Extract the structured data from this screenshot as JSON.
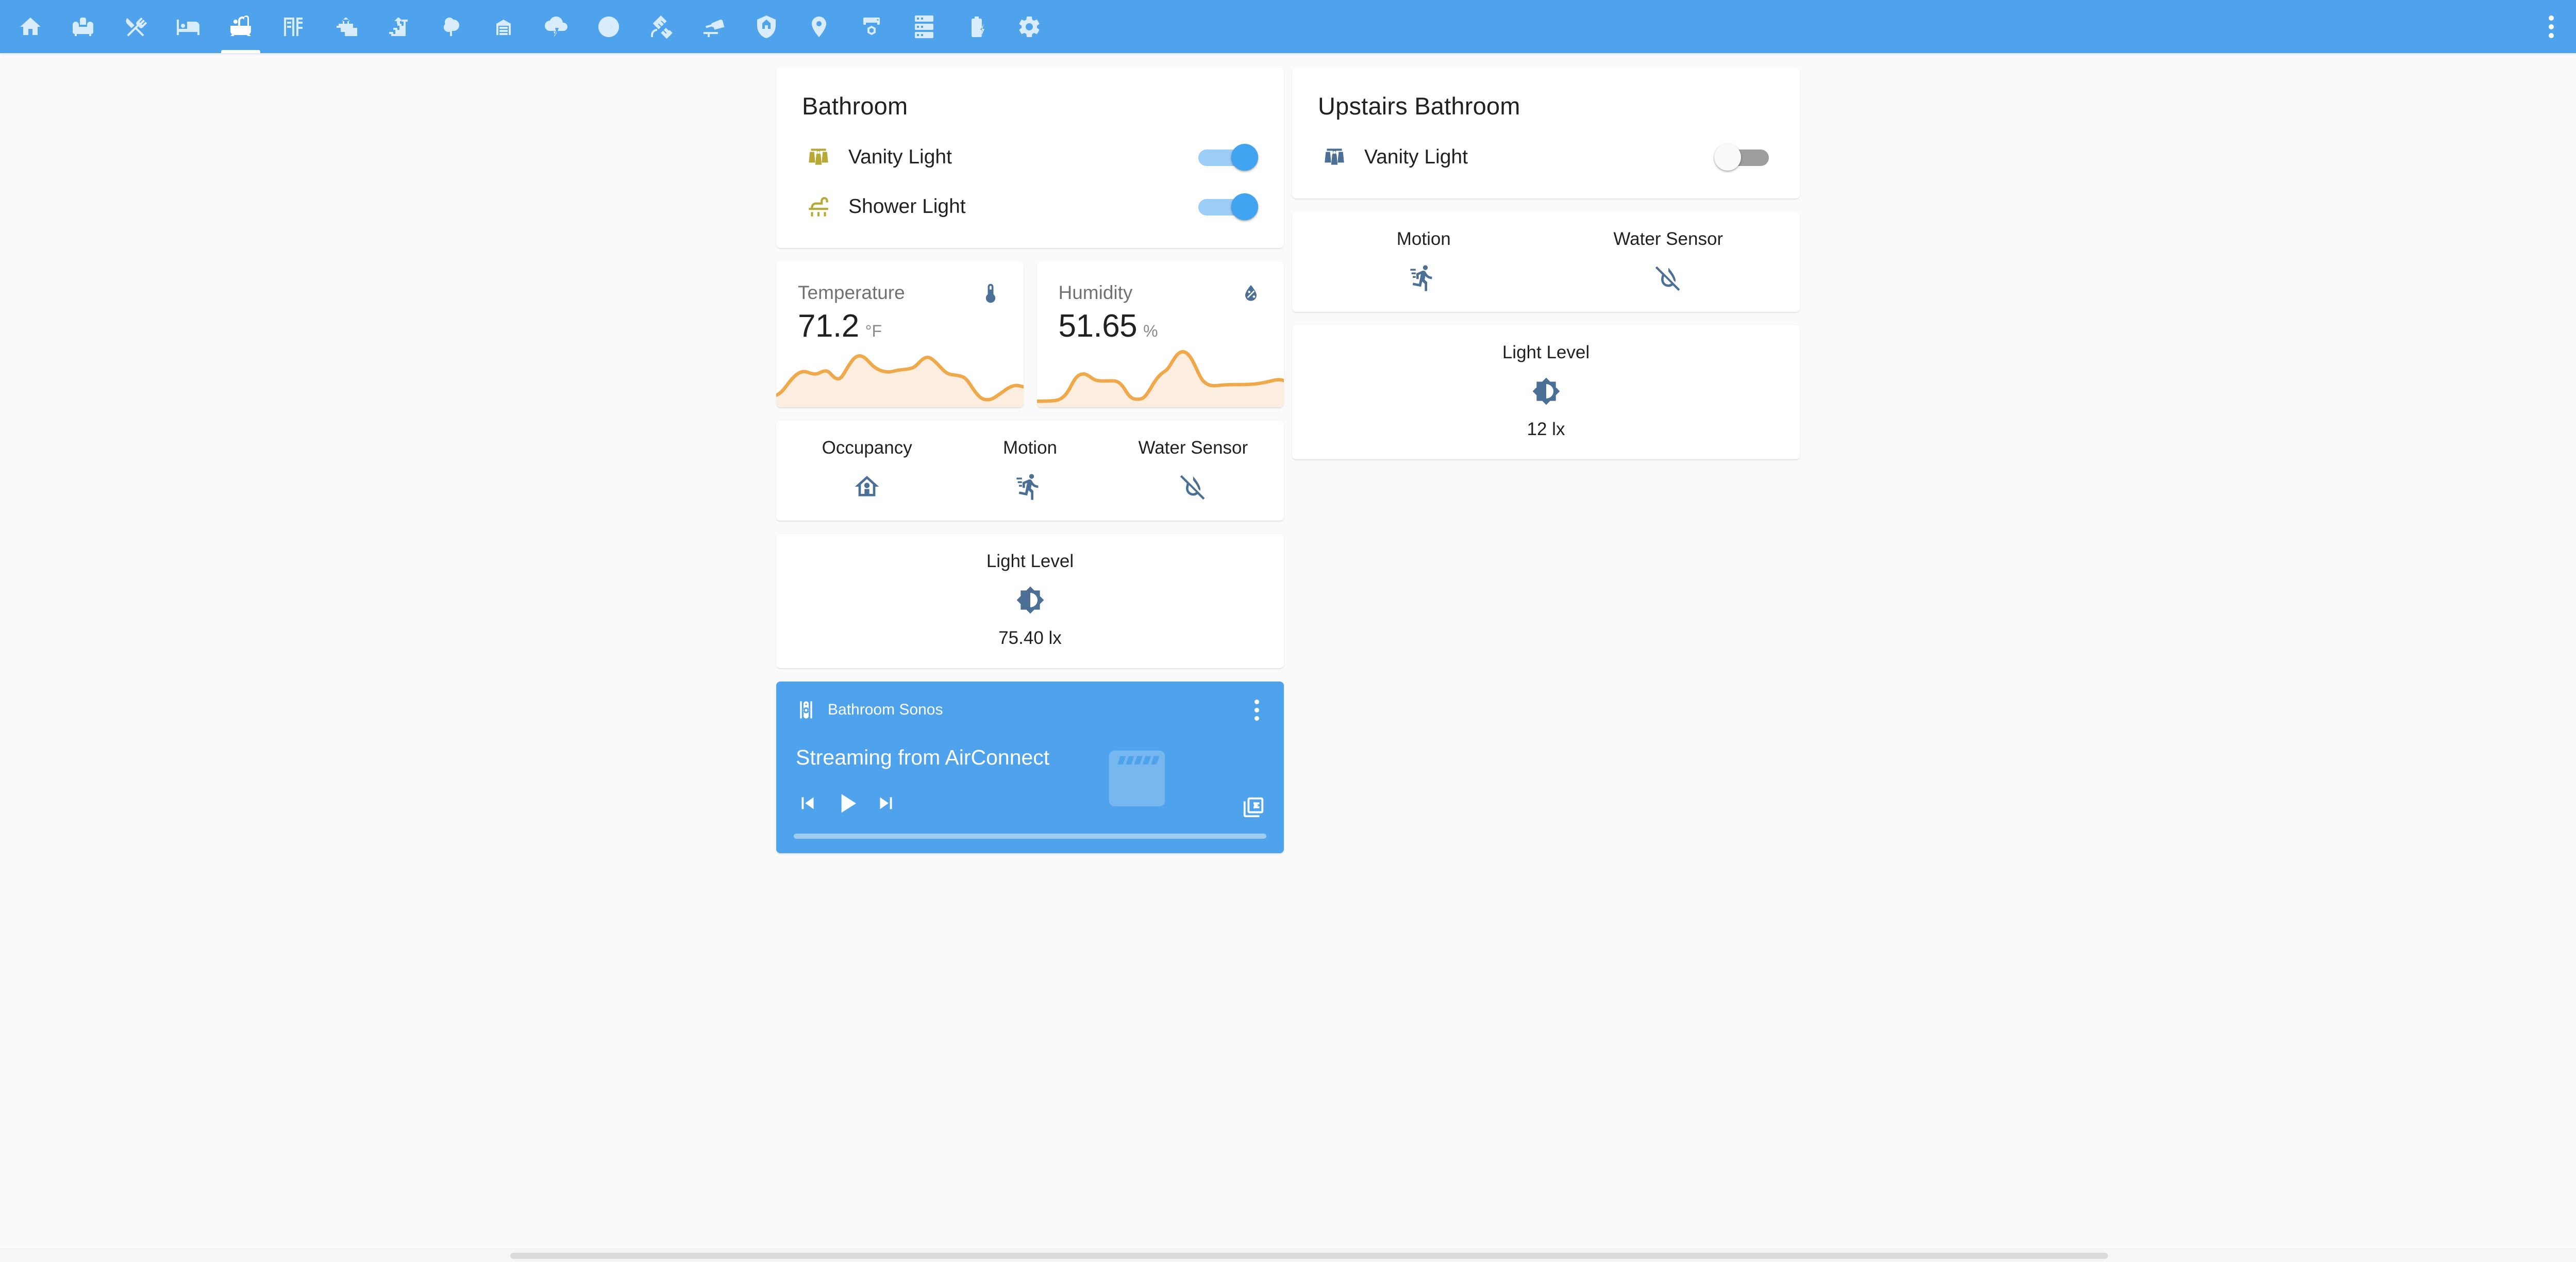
{
  "appbar": {
    "background": "#4fa3ec",
    "tabs": [
      {
        "icon": "home-icon",
        "name": "tab-home",
        "active": false
      },
      {
        "icon": "sofa-icon",
        "name": "tab-living-room",
        "active": false
      },
      {
        "icon": "silverware-icon",
        "name": "tab-kitchen",
        "active": false
      },
      {
        "icon": "bed-icon",
        "name": "tab-bedroom",
        "active": false
      },
      {
        "icon": "bathtub-icon",
        "name": "tab-bathroom",
        "active": true
      },
      {
        "icon": "desk-icon",
        "name": "tab-office",
        "active": false
      },
      {
        "icon": "stairs-down-icon",
        "name": "tab-downstairs",
        "active": false
      },
      {
        "icon": "stairs-up-icon",
        "name": "tab-upstairs",
        "active": false
      },
      {
        "icon": "tree-icon",
        "name": "tab-outside",
        "active": false
      },
      {
        "icon": "garage-icon",
        "name": "tab-garage",
        "active": false
      },
      {
        "icon": "weather-lightning-icon",
        "name": "tab-weather",
        "active": false
      },
      {
        "icon": "play-circle-icon",
        "name": "tab-media",
        "active": false
      },
      {
        "icon": "satellite-icon",
        "name": "tab-satellite",
        "active": false
      },
      {
        "icon": "cctv-icon",
        "name": "tab-cameras",
        "active": false
      },
      {
        "icon": "shield-home-icon",
        "name": "tab-security",
        "active": false
      },
      {
        "icon": "map-marker-icon",
        "name": "tab-location",
        "active": false
      },
      {
        "icon": "printer-3d-icon",
        "name": "tab-3d-printer",
        "active": false
      },
      {
        "icon": "server-icon",
        "name": "tab-system",
        "active": false
      },
      {
        "icon": "battery-charging-icon",
        "name": "tab-energy",
        "active": false
      },
      {
        "icon": "cog-icon",
        "name": "tab-settings",
        "active": false
      }
    ],
    "overflow_icon": "dots-vertical-icon"
  },
  "bathroom": {
    "title": "Bathroom",
    "lights": [
      {
        "name": "Vanity Light",
        "icon": "vanity-light-icon",
        "state": "on"
      },
      {
        "name": "Shower Light",
        "icon": "shower-icon",
        "state": "on"
      }
    ],
    "temperature": {
      "label": "Temperature",
      "value": "71.2",
      "unit": "°F",
      "icon": "thermometer-icon"
    },
    "humidity": {
      "label": "Humidity",
      "value": "51.65",
      "unit": "%",
      "icon": "water-percent-icon"
    },
    "sensors": [
      {
        "label": "Occupancy",
        "icon": "home-outline-icon"
      },
      {
        "label": "Motion",
        "icon": "run-icon"
      },
      {
        "label": "Water Sensor",
        "icon": "water-off-icon"
      }
    ],
    "light_level": {
      "label": "Light Level",
      "icon": "brightness-icon",
      "value": "75.40 lx"
    },
    "media": {
      "device": "Bathroom Sonos",
      "status": "Streaming from AirConnect",
      "device_icon": "speaker-icon",
      "more_icon": "dots-vertical-icon",
      "prev_icon": "skip-previous-icon",
      "play_icon": "play-icon",
      "next_icon": "skip-next-icon",
      "browse_icon": "browse-media-icon",
      "art_icon": "music-album-icon",
      "progress_percent": 100,
      "accent": "#4fa3ec"
    }
  },
  "upstairs_bathroom": {
    "title": "Upstairs Bathroom",
    "lights": [
      {
        "name": "Vanity Light",
        "icon": "vanity-light-icon",
        "state": "off"
      }
    ],
    "sensors": [
      {
        "label": "Motion",
        "icon": "run-icon"
      },
      {
        "label": "Water Sensor",
        "icon": "water-off-icon"
      }
    ],
    "light_level": {
      "label": "Light Level",
      "icon": "brightness-icon",
      "value": "12 lx"
    }
  },
  "colors": {
    "accent": "#4fa3ec",
    "light_on": "#b7a936",
    "state_icon": "#4b6f95",
    "sparkline": "#efa94a",
    "sparkline_fill": "#fbeee0",
    "background": "#fafafa",
    "card": "#ffffff"
  }
}
